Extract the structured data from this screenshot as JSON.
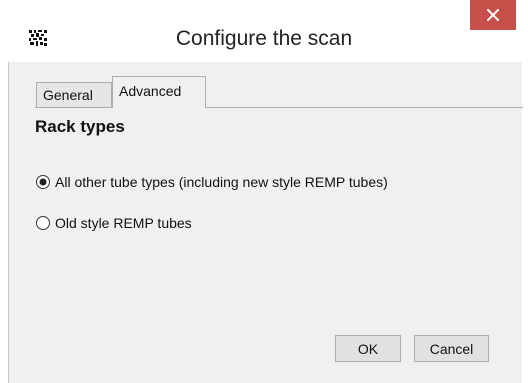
{
  "window": {
    "title": "Configure the scan",
    "icon": "barcode-icon",
    "close_icon": "close-icon",
    "close_color": "#c7504b"
  },
  "tabs": [
    {
      "label": "General",
      "selected": false
    },
    {
      "label": "Advanced",
      "selected": true
    }
  ],
  "section": {
    "title": "Rack types"
  },
  "options": [
    {
      "label": "All other tube types (including new style REMP tubes)",
      "checked": true
    },
    {
      "label": "Old style REMP tubes",
      "checked": false
    }
  ],
  "buttons": {
    "ok": "OK",
    "cancel": "Cancel"
  }
}
